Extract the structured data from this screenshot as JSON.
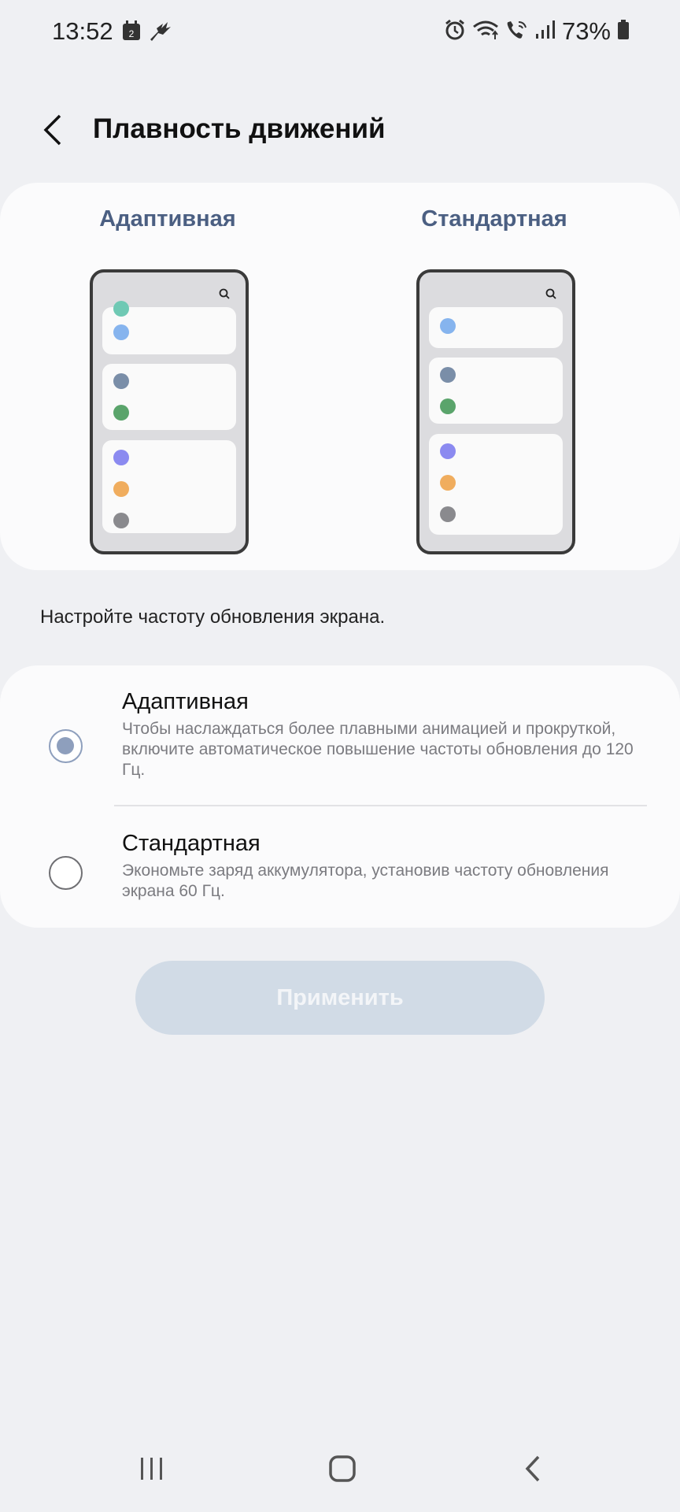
{
  "status": {
    "time": "13:52",
    "battery": "73%",
    "left_icons": [
      "calendar-icon",
      "feather-icon"
    ],
    "right_icons": [
      "alarm-icon",
      "wifi-icon",
      "wifi-call-icon",
      "signal-icon",
      "battery-icon"
    ],
    "calendar_number": "2"
  },
  "header": {
    "title": "Плавность движений",
    "back_icon": "chevron-left-icon"
  },
  "preview": {
    "left_label": "Адаптивная",
    "right_label": "Стандартная",
    "dot_colors": [
      "#6fc9b4",
      "#86b4ee",
      "#7a8ea8",
      "#5aa46b",
      "#8b8af0",
      "#f0ad5e",
      "#8a8a8e"
    ]
  },
  "hint": "Настройте частоту обновления экрана.",
  "options": [
    {
      "title": "Адаптивная",
      "description": "Чтобы наслаждаться более плавными анимацией и прокруткой, включите автоматическое повышение частоты обновления до 120 Гц.",
      "selected": true
    },
    {
      "title": "Стандартная",
      "description": "Экономьте заряд аккумулятора, установив частоту обновления экрана 60 Гц.",
      "selected": false
    }
  ],
  "apply_label": "Применить",
  "nav": {
    "recent_icon": "recent-apps-icon",
    "home_icon": "home-icon",
    "back_icon": "back-icon"
  },
  "colors": {
    "accent": "#8e9fbd",
    "label_blue": "#4b5f82",
    "background": "#eff0f3"
  }
}
